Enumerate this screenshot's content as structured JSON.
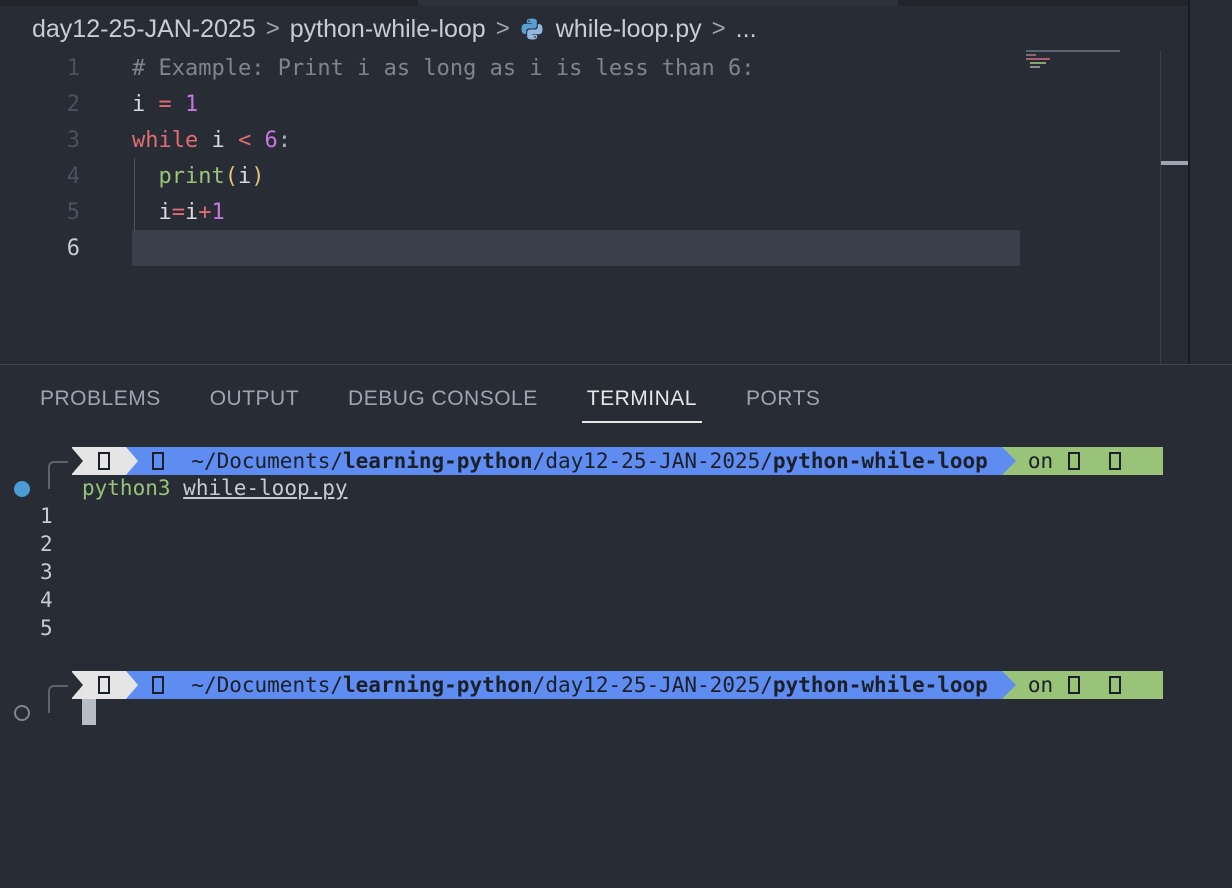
{
  "breadcrumb": {
    "items": [
      "day12-25-JAN-2025",
      "python-while-loop",
      "while-loop.py",
      "..."
    ],
    "separator": ">"
  },
  "editor": {
    "active_line": 6,
    "lines": [
      {
        "num": "1",
        "text": "# Example: Print i as long as i is less than 6:"
      },
      {
        "num": "2",
        "text": "i = 1"
      },
      {
        "num": "3",
        "text": "while i < 6:"
      },
      {
        "num": "4",
        "text": "print(i)"
      },
      {
        "num": "5",
        "text": "i=i+1"
      },
      {
        "num": "6",
        "text": ""
      }
    ]
  },
  "panel": {
    "tabs": [
      "PROBLEMS",
      "OUTPUT",
      "DEBUG CONSOLE",
      "TERMINAL",
      "PORTS"
    ],
    "active_tab": "TERMINAL"
  },
  "terminal": {
    "prompt": {
      "path_prefix": "~/Documents/",
      "path_bold1": "learning-python",
      "path_mid": "/day12-25-JAN-2025/",
      "path_bold2": "python-while-loop",
      "on_label": "on"
    },
    "command_prog": "python3",
    "command_file": "while-loop.py",
    "output": [
      "1",
      "2",
      "3",
      "4",
      "5"
    ]
  },
  "colors": {
    "background": "#282c34",
    "prompt_blue": "#5f8cf0",
    "prompt_green": "#98c379",
    "status_dot": "#4d9bd4"
  },
  "icons": [
    "python-file-icon",
    "chevron-right-icon",
    "terminal-os-icon",
    "folder-icon",
    "git-branch-icon"
  ]
}
